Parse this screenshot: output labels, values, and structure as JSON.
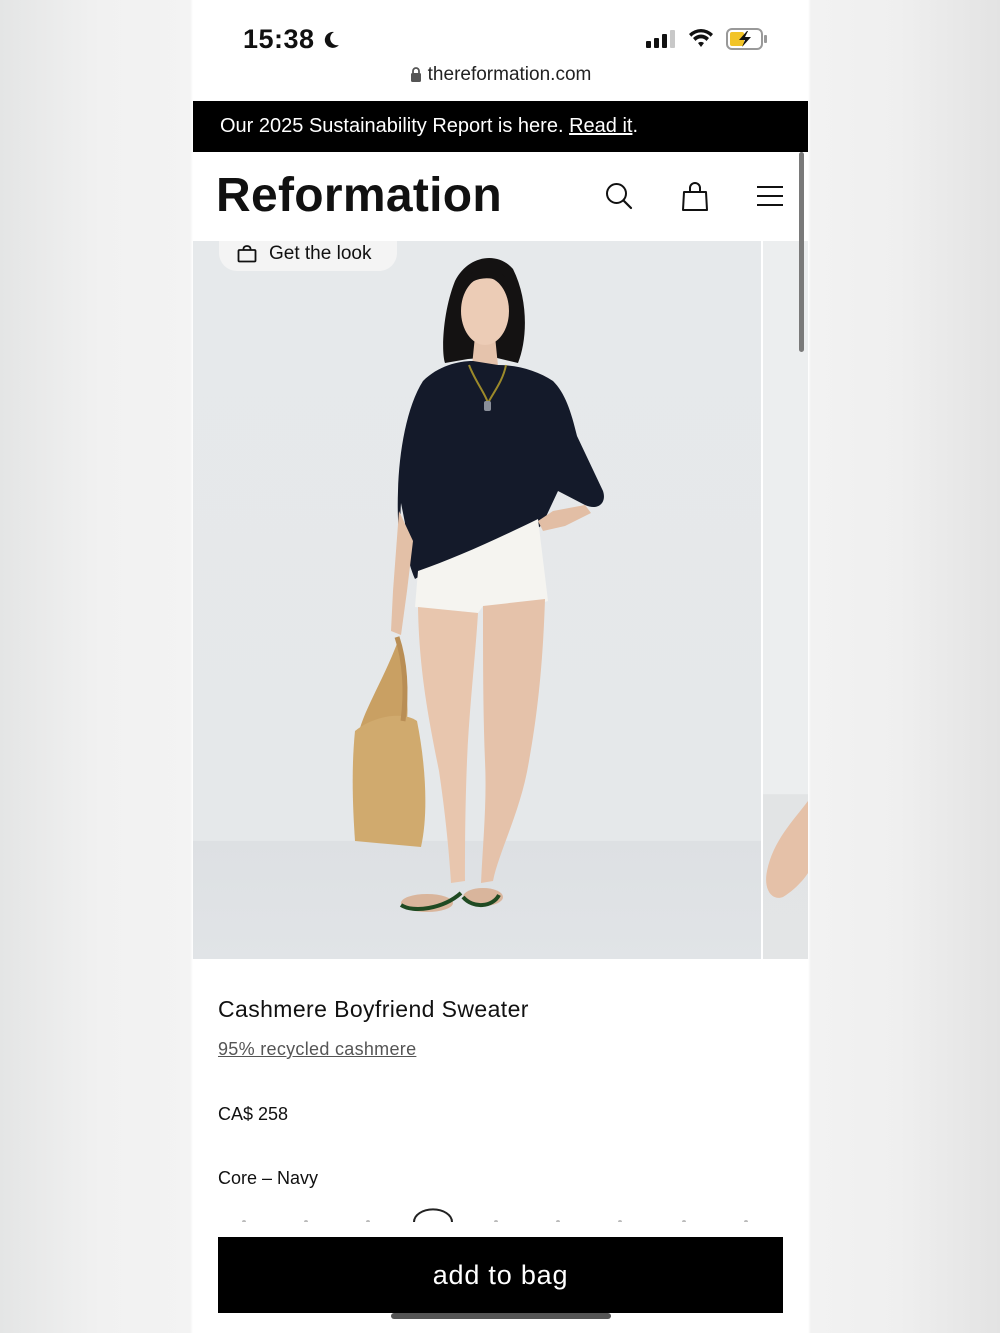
{
  "status_bar": {
    "time": "15:38"
  },
  "browser": {
    "url": "thereformation.com"
  },
  "announcement": {
    "text": "Our 2025 Sustainability Report is here. ",
    "link": "Read it",
    "suffix": "."
  },
  "header": {
    "logo": "Reformation"
  },
  "hero": {
    "get_the_look": "Get the look"
  },
  "product": {
    "title": "Cashmere Boyfriend Sweater",
    "material": "95% recycled cashmere",
    "price": "CA$ 258",
    "color": "Core – Navy"
  },
  "actions": {
    "add_to_bag": "add to bag"
  },
  "colors": {
    "sweater": "#141a2a",
    "shorts": "#f5f4f0",
    "bag": "#d0aa6e",
    "accent_black": "#000000"
  }
}
